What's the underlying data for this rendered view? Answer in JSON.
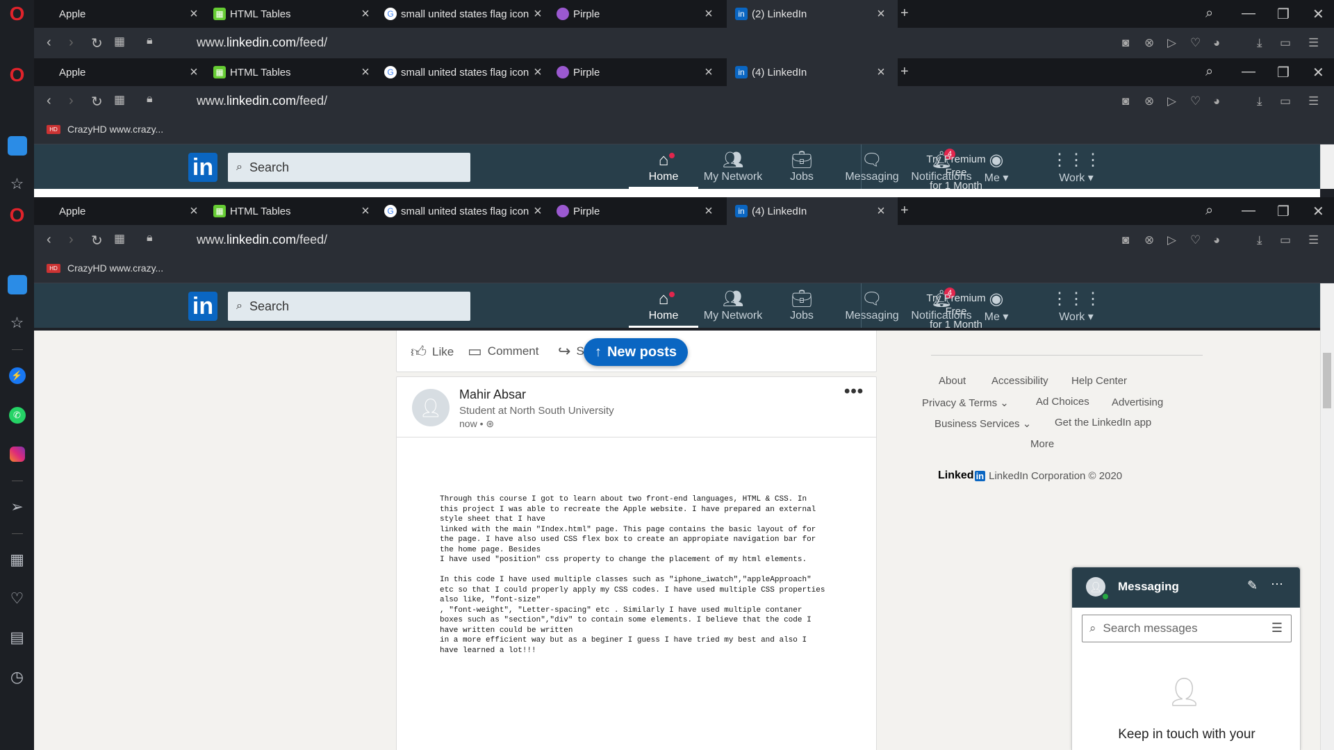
{
  "browser": {
    "tabs": [
      {
        "label": "Apple",
        "icon": "apple-icon"
      },
      {
        "label": "HTML Tables",
        "icon": "html-tables-icon"
      },
      {
        "label": "small united states flag icon",
        "icon": "google-icon"
      },
      {
        "label": "Pirple",
        "icon": "pirple-icon"
      }
    ],
    "active_tab_1": "(2) LinkedIn",
    "active_tab_2": "(4) LinkedIn",
    "active_tab_3": "(4) LinkedIn",
    "url_prefix": "www.",
    "url_domain": "linkedin.com",
    "url_path": "/feed/",
    "bookmark": "CrazyHD www.crazy...",
    "bookmark_badge": "HD"
  },
  "linkedin": {
    "logo": "in",
    "search_placeholder": "Search",
    "nav": [
      {
        "label": "Home",
        "icon": "home-icon"
      },
      {
        "label": "My Network",
        "icon": "network-icon"
      },
      {
        "label": "Jobs",
        "icon": "jobs-icon"
      },
      {
        "label": "Messaging",
        "icon": "messaging-icon"
      },
      {
        "label": "Notifications",
        "icon": "notifications-icon"
      },
      {
        "label": "Me",
        "icon": "avatar-icon"
      },
      {
        "label": "Work",
        "icon": "grid-icon"
      }
    ],
    "notifications_count": "4",
    "premium_line1": "Try Premium Free",
    "premium_line2": "for 1 Month"
  },
  "feed": {
    "actions": {
      "like": "Like",
      "comment": "Comment",
      "share": "Sh"
    },
    "new_posts": "New posts",
    "post": {
      "author": "Mahir Absar",
      "subtitle": "Student at North South University",
      "time": "now •",
      "menu": "•••",
      "text": "Through this course I got to learn about two front-end languages, HTML & CSS. In\nthis project I was able to recreate the Apple website. I have prepared an external\nstyle sheet that I have\nlinked with the main \"Index.html\" page. This page contains the basic layout of for\nthe page. I have also used CSS flex box to create an appropiate navigation bar for\nthe home page. Besides\nI have used \"position\" css property to change the placement of my html elements.\n\nIn this code I have used multiple classes such as \"iphone_iwatch\",\"appleApproach\"\netc so that I could properly apply my CSS codes. I have used multiple CSS properties\nalso like, \"font-size\"\n, \"font-weight\", \"Letter-spacing\" etc . Similarly I have used multiple contaner\nboxes such as \"section\",\"div\" to contain some elements. I believe that the code I\nhave written could be written\nin a more efficient way but as a beginer I guess I have tried my best and also I\nhave learned a lot!!!"
    }
  },
  "footer": {
    "about": "About",
    "accessibility": "Accessibility",
    "help": "Help Center",
    "privacy": "Privacy & Terms",
    "adchoices": "Ad Choices",
    "advertising": "Advertising",
    "business": "Business Services",
    "getapp": "Get the LinkedIn app",
    "more": "More",
    "brand_word": "Linked",
    "brand_in": "in",
    "copyright": "LinkedIn Corporation © 2020"
  },
  "messaging": {
    "title": "Messaging",
    "search_placeholder": "Search messages",
    "empty_text": "Keep in touch with your"
  },
  "colors": {
    "linkedin_header": "#283e4a",
    "linkedin_blue": "#0a66c2",
    "opera_red": "#e0232b",
    "badge_red": "#e2264d"
  }
}
